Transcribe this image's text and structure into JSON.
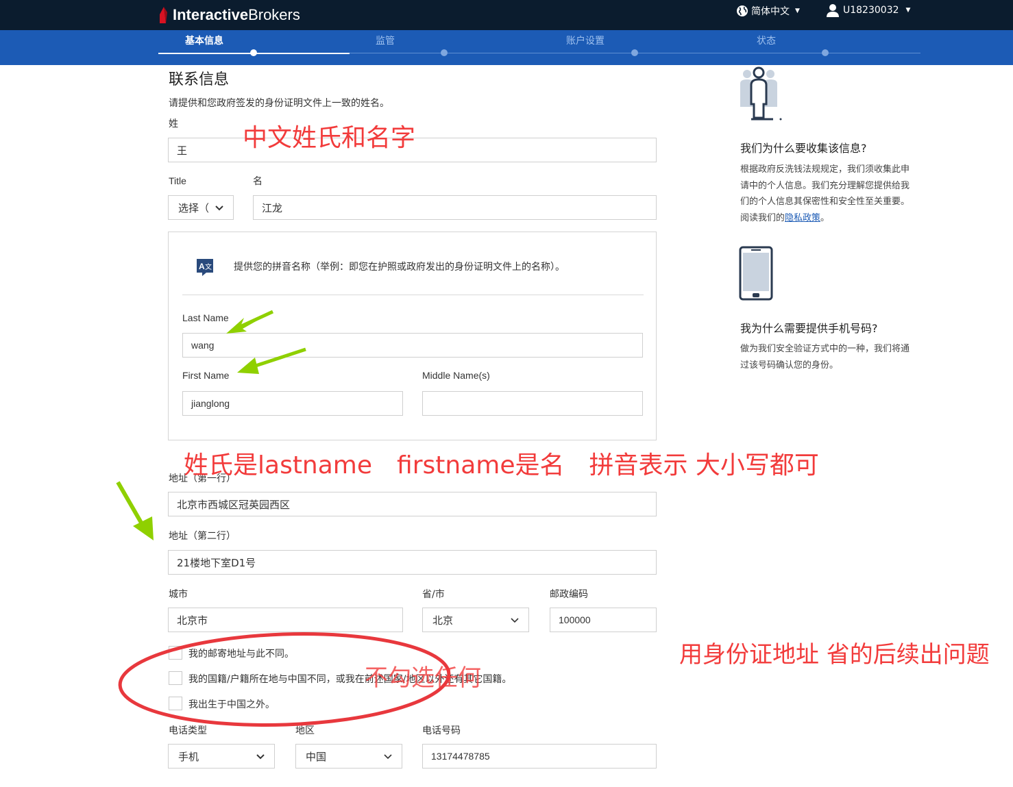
{
  "header": {
    "brand_bold": "Interactive",
    "brand_rest": "Brokers",
    "language": "简体中文",
    "account": "U18230032"
  },
  "steps": [
    {
      "label": "基本信息",
      "active": true
    },
    {
      "label": "监管",
      "active": false
    },
    {
      "label": "账户设置",
      "active": false
    },
    {
      "label": "状态",
      "active": false
    }
  ],
  "form": {
    "section_title": "联系信息",
    "section_note": "请提供和您政府签发的身份证明文件上一致的姓名。",
    "surname_label": "姓",
    "surname_value": "王",
    "title_label": "Title",
    "title_value": "选择（",
    "given_label": "名",
    "given_value": "江龙",
    "pinyin_note": "提供您的拼音名称（举例：即您在护照或政府发出的身份证明文件上的名称）。",
    "last_name_label": "Last Name",
    "last_name_value": "wang",
    "first_name_label": "First Name",
    "first_name_value": "jianglong",
    "middle_name_label": "Middle Name(s)",
    "middle_name_value": "",
    "address1_label": "地址（第一行）",
    "address1_value": "北京市西城区冠英园西区",
    "address2_label": "地址（第二行）",
    "address2_value": "21楼地下室D1号",
    "city_label": "城市",
    "city_value": "北京市",
    "province_label": "省/市",
    "province_value": "北京",
    "postal_label": "邮政编码",
    "postal_value": "100000",
    "checkbox_mail": "我的邮寄地址与此不同。",
    "checkbox_nationality": "我的国籍/户籍所在地与中国不同，或我在前述国家/地区以外还有其它国籍。",
    "checkbox_born": "我出生于中国之外。",
    "phone_type_label": "电话类型",
    "phone_type_value": "手机",
    "region_label": "地区",
    "region_value": "中国",
    "phone_number_label": "电话号码",
    "phone_number_value": "13174478785"
  },
  "right_panel": {
    "q1_title": "我们为什么要收集该信息?",
    "q1_text": "根据政府反洗钱法规规定，我们须收集此申请中的个人信息。我们充分理解您提供给我们的个人信息其保密性和安全性至关重要。阅读我们的",
    "q1_link": "隐私政策",
    "q1_end": "。",
    "q2_title": "我为什么需要提供手机号码?",
    "q2_text": "做为我们安全验证方式中的一种，我们将通过该号码确认您的身份。"
  },
  "annotations": {
    "a1": "中文姓氏和名字",
    "a2": "姓氏是lastname　firstname是名　拼音表示 大小写都可",
    "a3": "用身份证地址 省的后续出问题",
    "a4": "不勾选任何"
  },
  "colors": {
    "topbar": "#0b1c2e",
    "stepbar": "#1c5bb5",
    "annotation_red": "#f23b3b",
    "arrow_green": "#8fd000"
  }
}
